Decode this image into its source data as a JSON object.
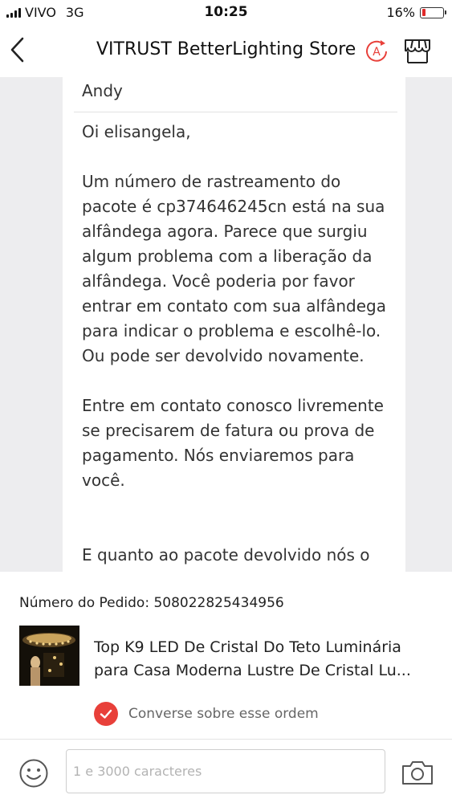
{
  "status_bar": {
    "carrier": "VIVO",
    "network": "3G",
    "time": "10:25",
    "battery_text": "16%",
    "battery_level": 0.16,
    "battery_color": "#e02a2a"
  },
  "header": {
    "title": "VITRUST BetterLighting Store",
    "badge_letter": "A",
    "accent_color": "#e8403a"
  },
  "message": {
    "sender": "Andy",
    "paragraphs": [
      "Oi elisangela,",
      "Um número de rastreamento do pacote é cp374646245cn está na sua alfândega agora. Parece que surgiu algum problema com a liberação da alfândega. Você poderia por favor entrar em contato com sua alfândega para indicar o problema e escolhê-lo. Ou pode ser devolvido novamente.",
      "Entre em contato conosco livremente se precisarem de fatura ou prova de pagamento. Nós enviaremos para você.",
      "E quanto ao pacote devolvido nós o"
    ]
  },
  "order": {
    "number_label": "Número do Pedido: 508022825434956",
    "product_title_line1": "Top K9 LED De Cristal Do Teto Luminária",
    "product_title_line2": "para Casa Moderna Lustre De Cristal Lu...",
    "chat_label": "Converse sobre esse ordem"
  },
  "composer": {
    "placeholder": "1 e 3000 caracteres",
    "value": ""
  }
}
